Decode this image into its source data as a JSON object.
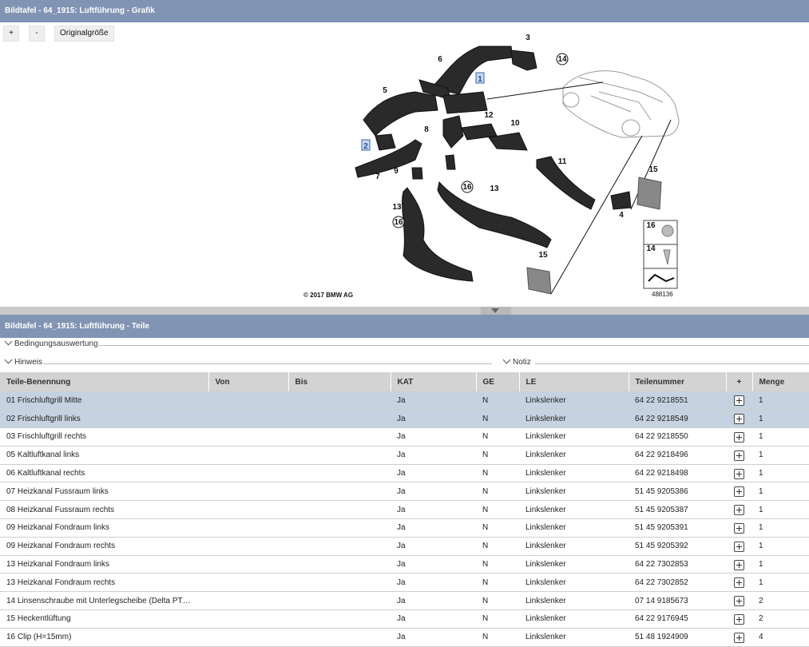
{
  "graphic_panel": {
    "title": "Bildtafel - 64_1915: Luftführung - Grafik",
    "zoom_in_label": "+",
    "zoom_out_label": "-",
    "original_size_label": "Originalgröße",
    "copyright": "© 2017 BMW AG",
    "image_number": "488136",
    "callouts": [
      "1",
      "2",
      "3",
      "4",
      "5",
      "6",
      "7",
      "8",
      "9",
      "10",
      "11",
      "12",
      "13",
      "13",
      "14",
      "15",
      "15",
      "16",
      "16"
    ],
    "legend_callouts": [
      "16",
      "14"
    ]
  },
  "parts_panel": {
    "title": "Bildtafel - 64_1915: Luftführung - Teile",
    "conditions_label": "Bedingungsauswertung",
    "hint_label": "Hinweis",
    "note_label": "Notiz",
    "columns": [
      "Teile-Benennung",
      "Von",
      "Bis",
      "KAT",
      "GE",
      "LE",
      "Teilenummer",
      "+",
      "Menge"
    ],
    "rows": [
      {
        "name": "01 Frischluftgrill Mitte",
        "von": "",
        "bis": "",
        "kat": "Ja",
        "ge": "N",
        "le": "Linkslenker",
        "teilenummer": "64 22 9218551",
        "menge": "1",
        "selected": true
      },
      {
        "name": "02 Frischluftgrill links",
        "von": "",
        "bis": "",
        "kat": "Ja",
        "ge": "N",
        "le": "Linkslenker",
        "teilenummer": "64 22 9218549",
        "menge": "1",
        "selected": true
      },
      {
        "name": "03 Frischluftgrill rechts",
        "von": "",
        "bis": "",
        "kat": "Ja",
        "ge": "N",
        "le": "Linkslenker",
        "teilenummer": "64 22 9218550",
        "menge": "1",
        "selected": false
      },
      {
        "name": "05 Kaltluftkanal links",
        "von": "",
        "bis": "",
        "kat": "Ja",
        "ge": "N",
        "le": "Linkslenker",
        "teilenummer": "64 22 9218496",
        "menge": "1",
        "selected": false
      },
      {
        "name": "06 Kaltluftkanal rechts",
        "von": "",
        "bis": "",
        "kat": "Ja",
        "ge": "N",
        "le": "Linkslenker",
        "teilenummer": "64 22 9218498",
        "menge": "1",
        "selected": false
      },
      {
        "name": "07 Heizkanal Fussraum links",
        "von": "",
        "bis": "",
        "kat": "Ja",
        "ge": "N",
        "le": "Linkslenker",
        "teilenummer": "51 45 9205386",
        "menge": "1",
        "selected": false
      },
      {
        "name": "08 Heizkanal Fussraum rechts",
        "von": "",
        "bis": "",
        "kat": "Ja",
        "ge": "N",
        "le": "Linkslenker",
        "teilenummer": "51 45 9205387",
        "menge": "1",
        "selected": false
      },
      {
        "name": "09 Heizkanal Fondraum links",
        "von": "",
        "bis": "",
        "kat": "Ja",
        "ge": "N",
        "le": "Linkslenker",
        "teilenummer": "51 45 9205391",
        "menge": "1",
        "selected": false
      },
      {
        "name": "09 Heizkanal Fondraum rechts",
        "von": "",
        "bis": "",
        "kat": "Ja",
        "ge": "N",
        "le": "Linkslenker",
        "teilenummer": "51 45 9205392",
        "menge": "1",
        "selected": false
      },
      {
        "name": "13 Heizkanal Fondraum links",
        "von": "",
        "bis": "",
        "kat": "Ja",
        "ge": "N",
        "le": "Linkslenker",
        "teilenummer": "64 22 7302853",
        "menge": "1",
        "selected": false
      },
      {
        "name": "13 Heizkanal Fondraum rechts",
        "von": "",
        "bis": "",
        "kat": "Ja",
        "ge": "N",
        "le": "Linkslenker",
        "teilenummer": "64 22 7302852",
        "menge": "1",
        "selected": false
      },
      {
        "name": "14 Linsenschraube mit Unterlegscheibe (Delta PT…",
        "von": "",
        "bis": "",
        "kat": "Ja",
        "ge": "N",
        "le": "Linkslenker",
        "teilenummer": "07 14 9185673",
        "menge": "2",
        "selected": false
      },
      {
        "name": "15 Heckentlüftung",
        "von": "",
        "bis": "",
        "kat": "Ja",
        "ge": "N",
        "le": "Linkslenker",
        "teilenummer": "64 22 9176945",
        "menge": "2",
        "selected": false
      },
      {
        "name": "16 Clip (H=15mm)",
        "von": "",
        "bis": "",
        "kat": "Ja",
        "ge": "N",
        "le": "Linkslenker",
        "teilenummer": "51 48 1924909",
        "menge": "4",
        "selected": false
      }
    ]
  }
}
